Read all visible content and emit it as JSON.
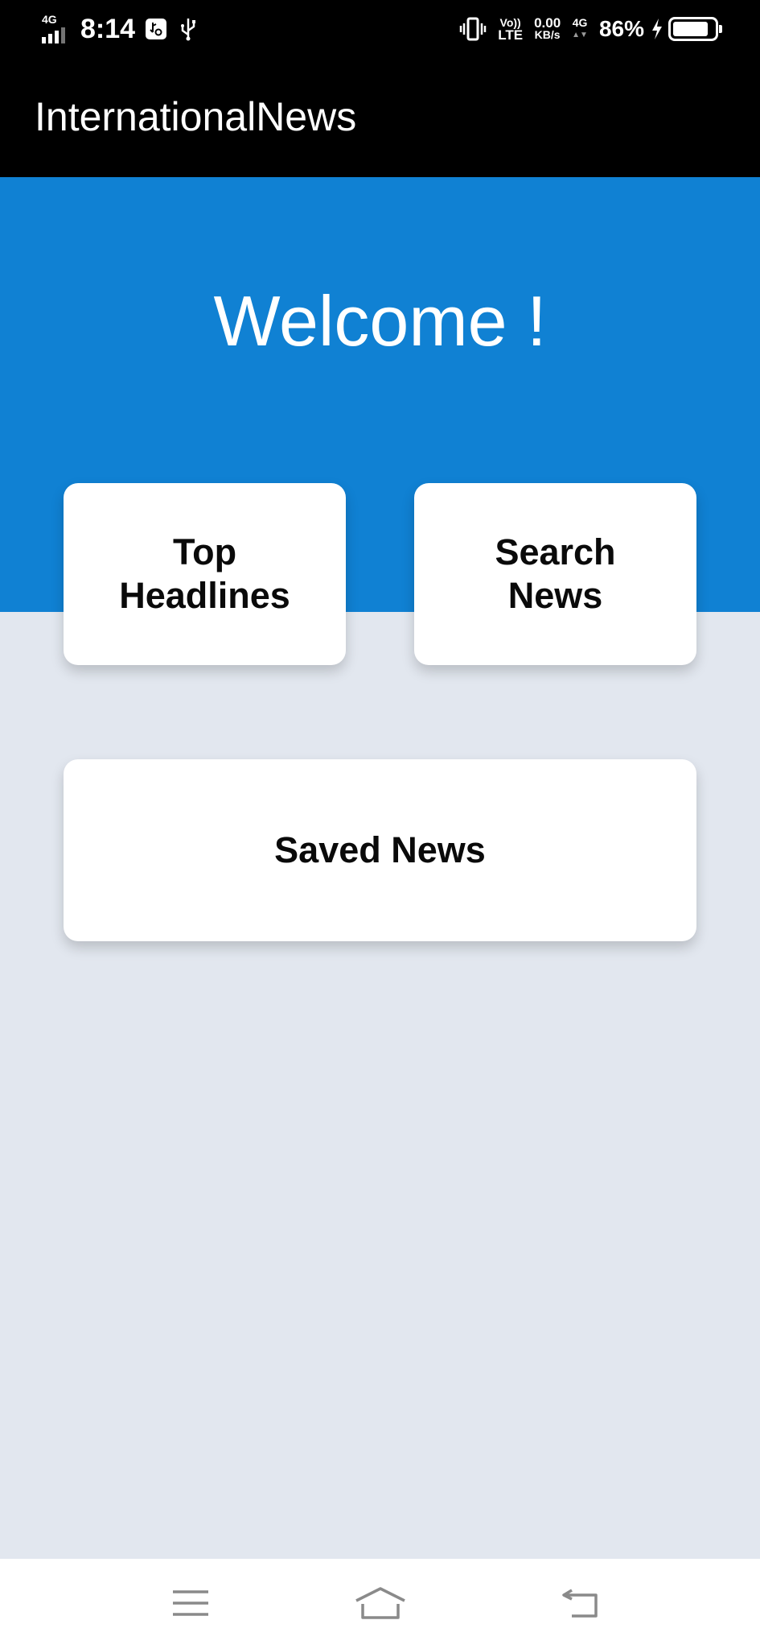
{
  "status_bar": {
    "network": "4G",
    "time": "8:14",
    "volte_top": "Vo))",
    "volte_bottom": "LTE",
    "speed_value": "0.00",
    "speed_unit": "KB/s",
    "data_network": "4G",
    "battery_percent": "86%",
    "battery_level": 0.86
  },
  "app_bar": {
    "title": "InternationalNews"
  },
  "hero": {
    "welcome": "Welcome !",
    "color": "#1081d3"
  },
  "cards": {
    "top_headlines": "Top\nHeadlines",
    "search_news": "Search\nNews",
    "saved_news": "Saved News"
  },
  "nav_bar": {
    "icons": [
      "menu-icon",
      "home-icon",
      "back-icon"
    ]
  },
  "colors": {
    "background": "#e2e7ef",
    "app_bar": "#000000",
    "accent": "#1081d3",
    "card": "#ffffff"
  }
}
